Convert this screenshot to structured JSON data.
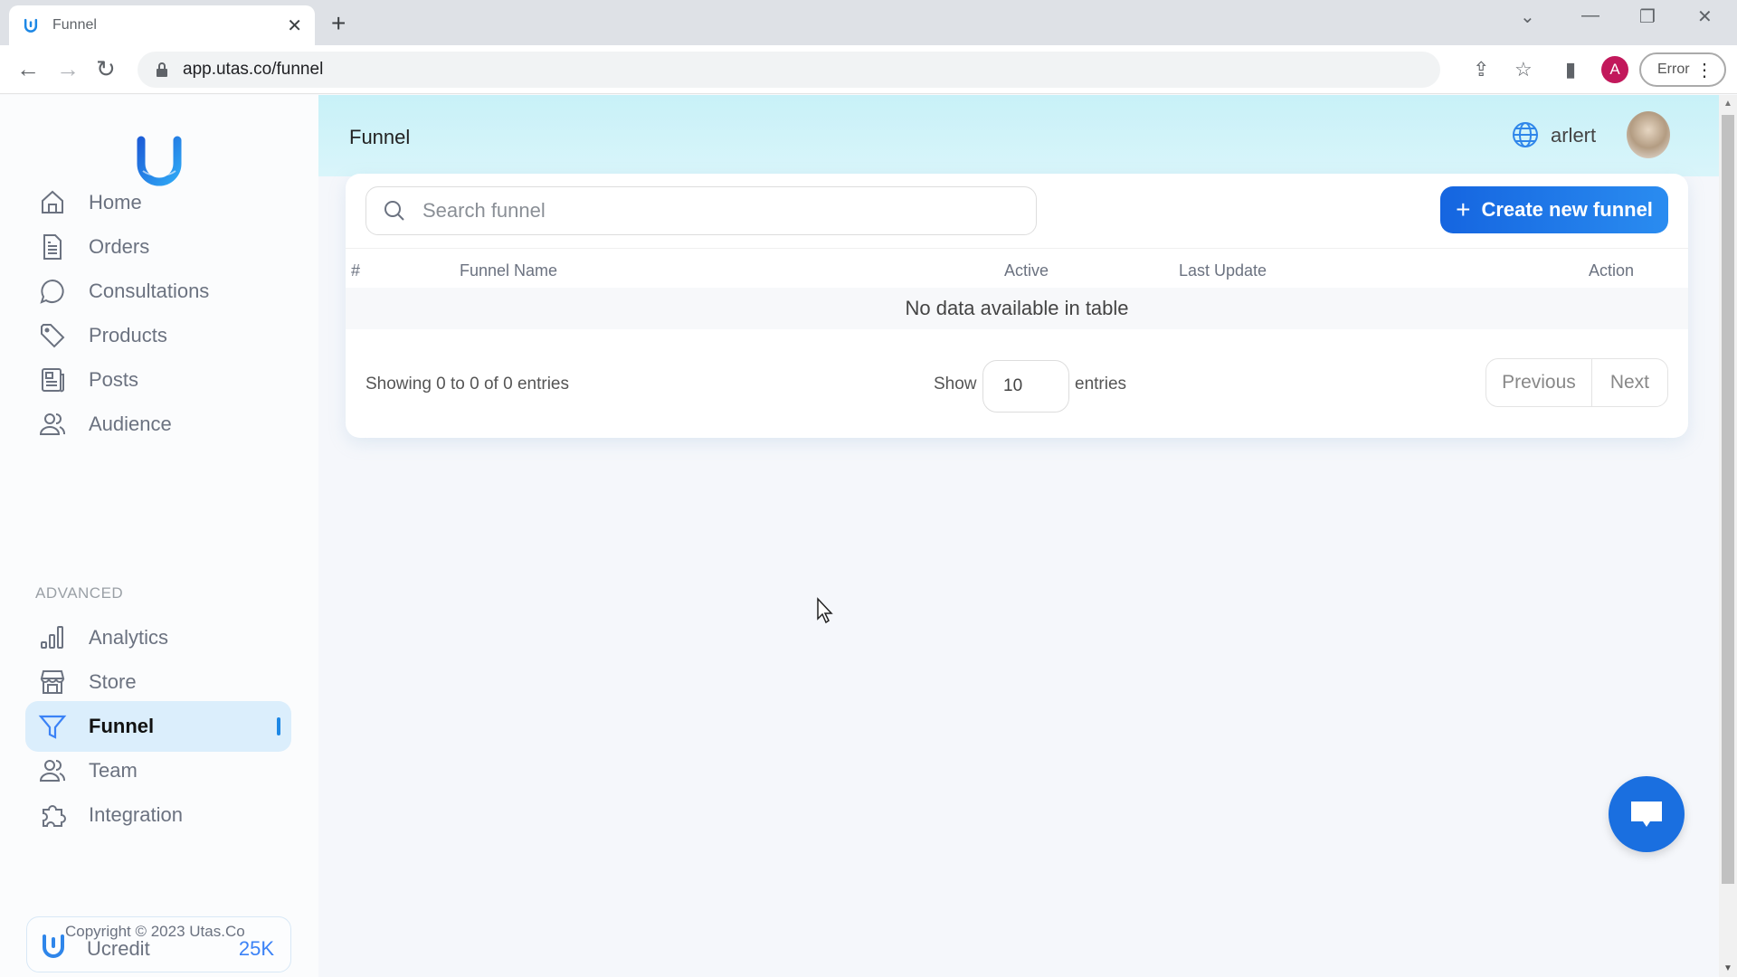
{
  "browser": {
    "tab_title": "Funnel",
    "url": "app.utas.co/funnel",
    "profile_initial": "A",
    "error_label": "Error"
  },
  "sidebar": {
    "brand": "utas",
    "items": [
      {
        "label": "Home",
        "icon": "home-icon"
      },
      {
        "label": "Orders",
        "icon": "document-icon"
      },
      {
        "label": "Consultations",
        "icon": "chat-bubble-icon"
      },
      {
        "label": "Products",
        "icon": "tag-icon"
      },
      {
        "label": "Posts",
        "icon": "newspaper-icon"
      },
      {
        "label": "Audience",
        "icon": "users-icon"
      }
    ],
    "section_label": "ADVANCED",
    "advanced_items": [
      {
        "label": "Analytics",
        "icon": "bar-chart-icon"
      },
      {
        "label": "Store",
        "icon": "store-icon"
      },
      {
        "label": "Funnel",
        "icon": "funnel-icon",
        "active": true
      },
      {
        "label": "Team",
        "icon": "users-icon"
      },
      {
        "label": "Integration",
        "icon": "puzzle-icon"
      }
    ],
    "credit": {
      "label": "Ucredit",
      "value": "25K"
    },
    "copyright": "Copyright © 2023 Utas.Co"
  },
  "header": {
    "title": "Funnel",
    "username": "arlert"
  },
  "main": {
    "search_placeholder": "Search funnel",
    "search_value": "",
    "create_button": "Create new funnel",
    "columns": [
      "#",
      "Funnel Name",
      "Active",
      "Last Update",
      "Action"
    ],
    "rows": [],
    "empty_message": "No data available in table",
    "showing_text": "Showing 0 to 0 of 0 entries",
    "show_label": "Show",
    "page_size": "10",
    "entries_label": "entries",
    "previous_label": "Previous",
    "next_label": "Next"
  },
  "colors": {
    "accent": "#1a6fe0",
    "active_nav_bg": "#dbeefc",
    "header_bg": "#c8f1f8"
  }
}
